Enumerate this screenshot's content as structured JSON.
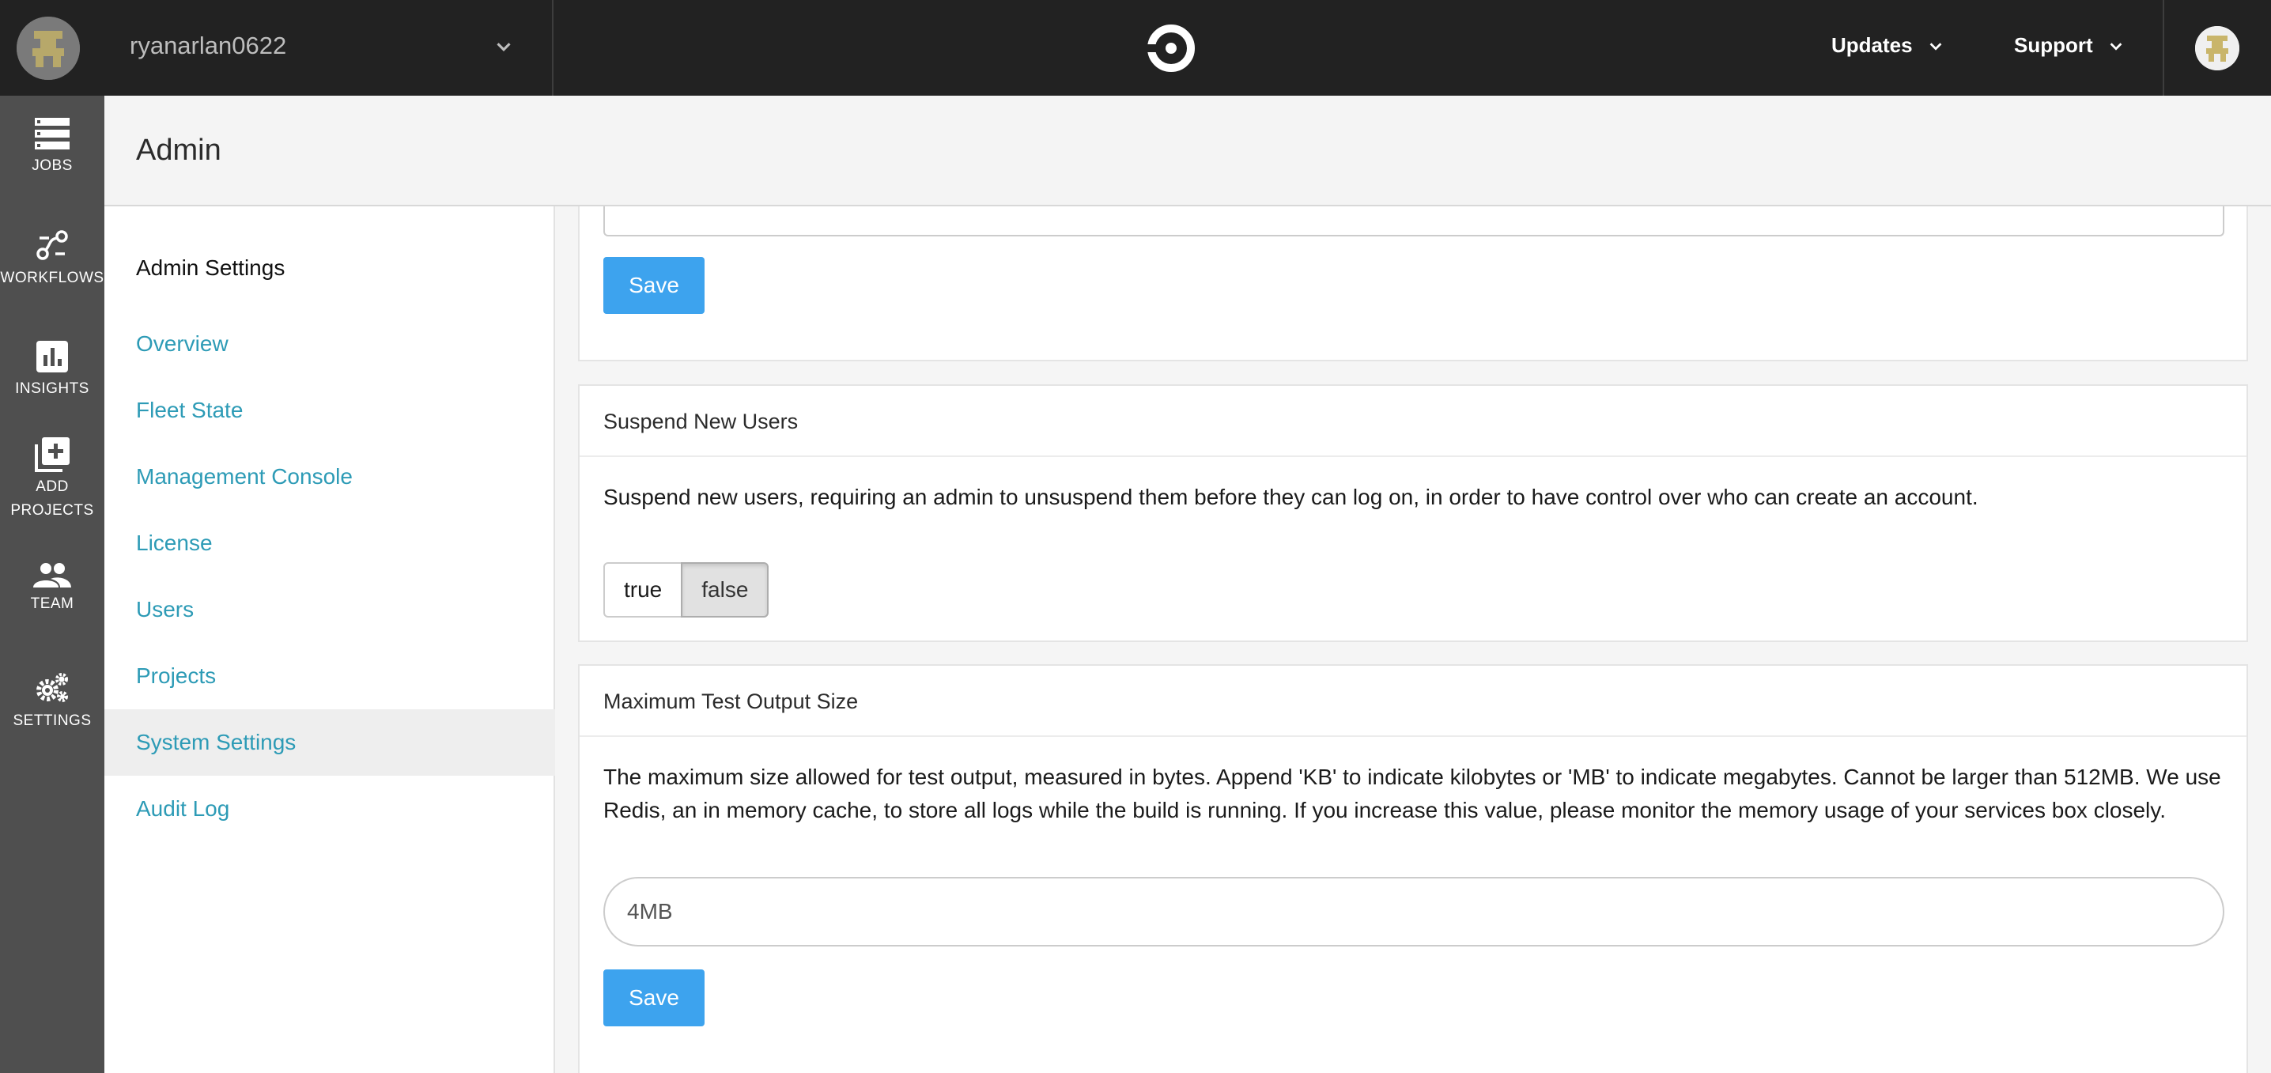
{
  "topbar": {
    "org_name": "ryanarlan0622",
    "logo_icon": "circleci-logo",
    "menus": [
      {
        "label": "Updates",
        "icon": "chevron-down-icon"
      },
      {
        "label": "Support",
        "icon": "chevron-down-icon"
      }
    ]
  },
  "sidebar": {
    "items": [
      {
        "label": "JOBS",
        "icon": "jobs-list-icon"
      },
      {
        "label": "WORKFLOWS",
        "icon": "workflows-icon"
      },
      {
        "label": "INSIGHTS",
        "icon": "insights-chart-icon"
      },
      {
        "label_line1": "ADD",
        "label_line2": "PROJECTS",
        "icon": "add-projects-icon"
      },
      {
        "label": "TEAM",
        "icon": "team-people-icon"
      },
      {
        "label": "SETTINGS",
        "icon": "settings-gears-icon"
      }
    ]
  },
  "page": {
    "title": "Admin"
  },
  "settings_nav": {
    "title": "Admin Settings",
    "links": [
      "Overview",
      "Fleet State",
      "Management Console",
      "License",
      "Users",
      "Projects",
      "System Settings",
      "Audit Log"
    ],
    "active": "System Settings"
  },
  "sections": {
    "top": {
      "save_label": "Save"
    },
    "suspend": {
      "title": "Suspend New Users",
      "description": "Suspend new users, requiring an admin to unsuspend them before they can log on, in order to have control over who can create an account.",
      "options": [
        "true",
        "false"
      ],
      "selected": "false"
    },
    "max_output": {
      "title": "Maximum Test Output Size",
      "description": "The maximum size allowed for test output, measured in bytes. Append 'KB' to indicate kilobytes or 'MB' to indicate megabytes. Cannot be larger than 512MB. We use Redis, an in memory cache, to store all logs while the build is running. If you increase this value, please monitor the memory usage of your services box closely.",
      "value": "4MB",
      "save_label": "Save"
    }
  },
  "colors": {
    "topbar": "#222222",
    "sidebar": "#4f4f4f",
    "link": "#2d9bb6",
    "primary_button": "#3da3ee"
  }
}
